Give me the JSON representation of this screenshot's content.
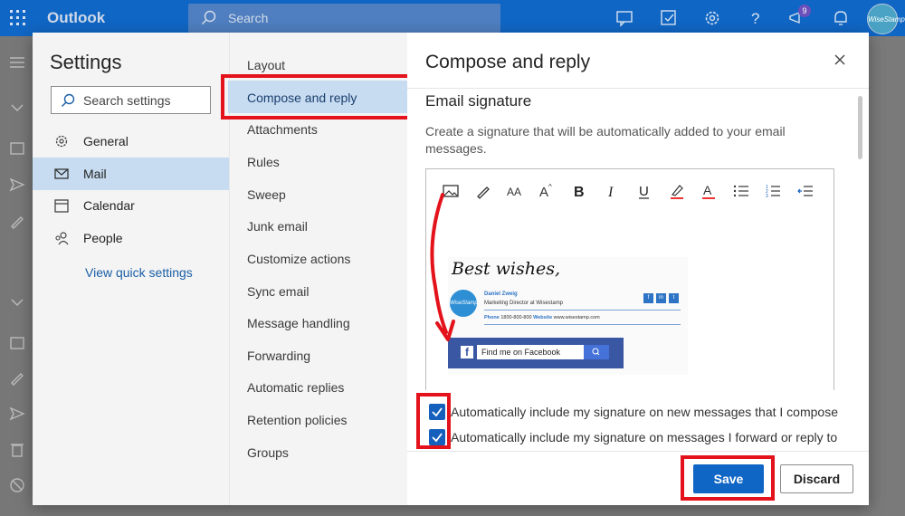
{
  "app": {
    "name": "Outlook"
  },
  "topbar": {
    "search_placeholder": "Search",
    "badge_count": "9",
    "avatar_text": "WiseStamp",
    "accent": "#1066c4"
  },
  "settings": {
    "title": "Settings",
    "search_placeholder": "Search settings",
    "nav": [
      {
        "label": "General",
        "icon": "gear-icon"
      },
      {
        "label": "Mail",
        "icon": "mail-icon",
        "active": true
      },
      {
        "label": "Calendar",
        "icon": "calendar-icon"
      },
      {
        "label": "People",
        "icon": "people-icon"
      }
    ],
    "view_quick": "View quick settings"
  },
  "mail_sections": [
    "Layout",
    "Compose and reply",
    "Attachments",
    "Rules",
    "Sweep",
    "Junk email",
    "Customize actions",
    "Sync email",
    "Message handling",
    "Forwarding",
    "Automatic replies",
    "Retention policies",
    "Groups"
  ],
  "panel": {
    "title": "Compose and reply",
    "section_title": "Email signature",
    "description": "Create a signature that will be automatically added to your email messages.",
    "signature": {
      "closing": "Best wishes,",
      "name": "Daniel Zweig",
      "role": "Marketing Director at Wisestamp",
      "phone_label": "Phone",
      "phone": "1800-800-800",
      "website_label": "Website",
      "website": "www.wisestamp.com",
      "logo_text": "WiseStamp",
      "facebook_cta": "Find me on Facebook"
    },
    "checkbox_new": "Automatically include my signature on new messages that I compose",
    "checkbox_reply": "Automatically include my signature on messages I forward or reply to",
    "checkbox_new_checked": true,
    "checkbox_reply_checked": true,
    "save_label": "Save",
    "discard_label": "Discard"
  },
  "annotation_color": "#e3121b"
}
